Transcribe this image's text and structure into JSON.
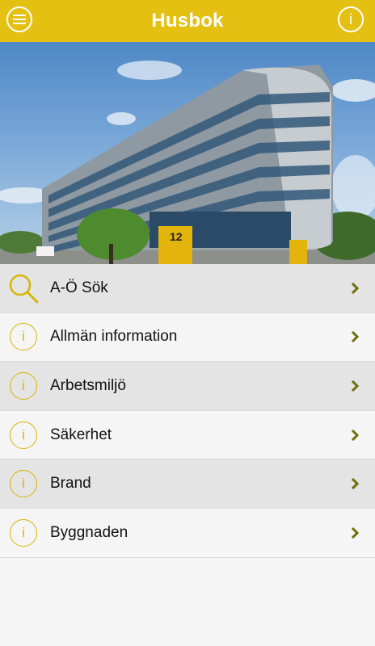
{
  "header": {
    "title": "Husbok",
    "menu_icon": "menu-icon",
    "info_icon": "info-icon",
    "info_glyph": "i"
  },
  "hero": {
    "sign_number": "12"
  },
  "colors": {
    "accent": "#e3c011",
    "icon": "#d9b400",
    "chevron": "#7a7a0a"
  },
  "menu": [
    {
      "label": "A-Ö Sök",
      "icon": "search-icon"
    },
    {
      "label": "Allmän information",
      "icon": "info-circle-icon",
      "glyph": "i"
    },
    {
      "label": "Arbetsmiljö",
      "icon": "info-circle-icon",
      "glyph": "i"
    },
    {
      "label": "Säkerhet",
      "icon": "info-circle-icon",
      "glyph": "i"
    },
    {
      "label": "Brand",
      "icon": "info-circle-icon",
      "glyph": "i"
    },
    {
      "label": "Byggnaden",
      "icon": "info-circle-icon",
      "glyph": "i"
    }
  ]
}
